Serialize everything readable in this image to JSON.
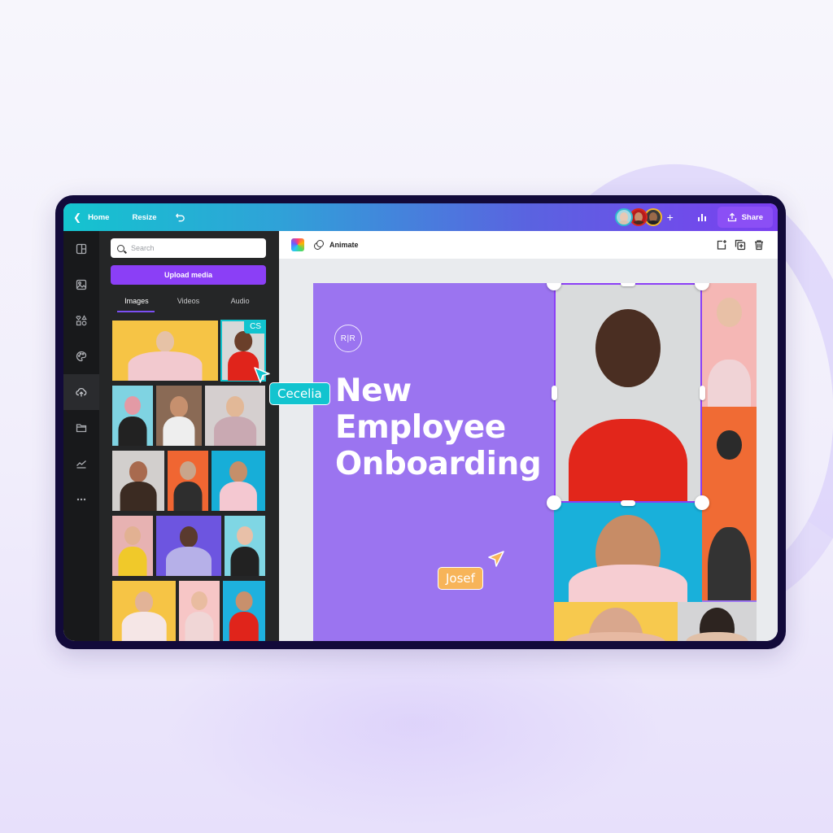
{
  "topbar": {
    "home_label": "Home",
    "resize_label": "Resize",
    "share_label": "Share",
    "collaborators": [
      {
        "name": "collaborator-1",
        "ring": "#2fb8d0",
        "bg": "#a8d8e2",
        "skin": "#e8c9b5",
        "cloth": "#d8c3b0"
      },
      {
        "name": "collaborator-2",
        "ring": "#d9281e",
        "bg": "#b71c1c",
        "skin": "#c98d6a",
        "cloth": "#4a2a20"
      },
      {
        "name": "collaborator-3",
        "ring": "#f3b72a",
        "bg": "#3a3a3a",
        "skin": "#9a6a4a",
        "cloth": "#222"
      }
    ]
  },
  "rail": {
    "items": [
      {
        "name": "templates",
        "icon": "layout-icon"
      },
      {
        "name": "photos",
        "icon": "image-icon"
      },
      {
        "name": "elements",
        "icon": "shapes-icon"
      },
      {
        "name": "styles",
        "icon": "palette-icon"
      },
      {
        "name": "uploads",
        "icon": "cloud-upload-icon",
        "active": true
      },
      {
        "name": "projects",
        "icon": "folder-icon"
      },
      {
        "name": "charts",
        "icon": "chart-line-icon"
      },
      {
        "name": "more",
        "icon": "more-icon"
      }
    ]
  },
  "panel": {
    "search_placeholder": "Search",
    "search_value": "",
    "upload_label": "Upload media",
    "tabs": [
      {
        "label": "Images",
        "active": true
      },
      {
        "label": "Videos"
      },
      {
        "label": "Audio"
      }
    ],
    "selected_badge": "CS"
  },
  "context_bar": {
    "animate_label": "Animate"
  },
  "design": {
    "logo_text": "R|R",
    "headline": [
      "New",
      "Employee",
      "Onboarding"
    ],
    "background": "#9b74f0"
  },
  "cursors": [
    {
      "name": "Cecelia",
      "color": "#12c4cf"
    },
    {
      "name": "Josef",
      "color": "#f7b459"
    }
  ],
  "colors": {
    "accent": "#8b3ff6",
    "selection": "#8b3ff6",
    "teal": "#12c4cf"
  }
}
